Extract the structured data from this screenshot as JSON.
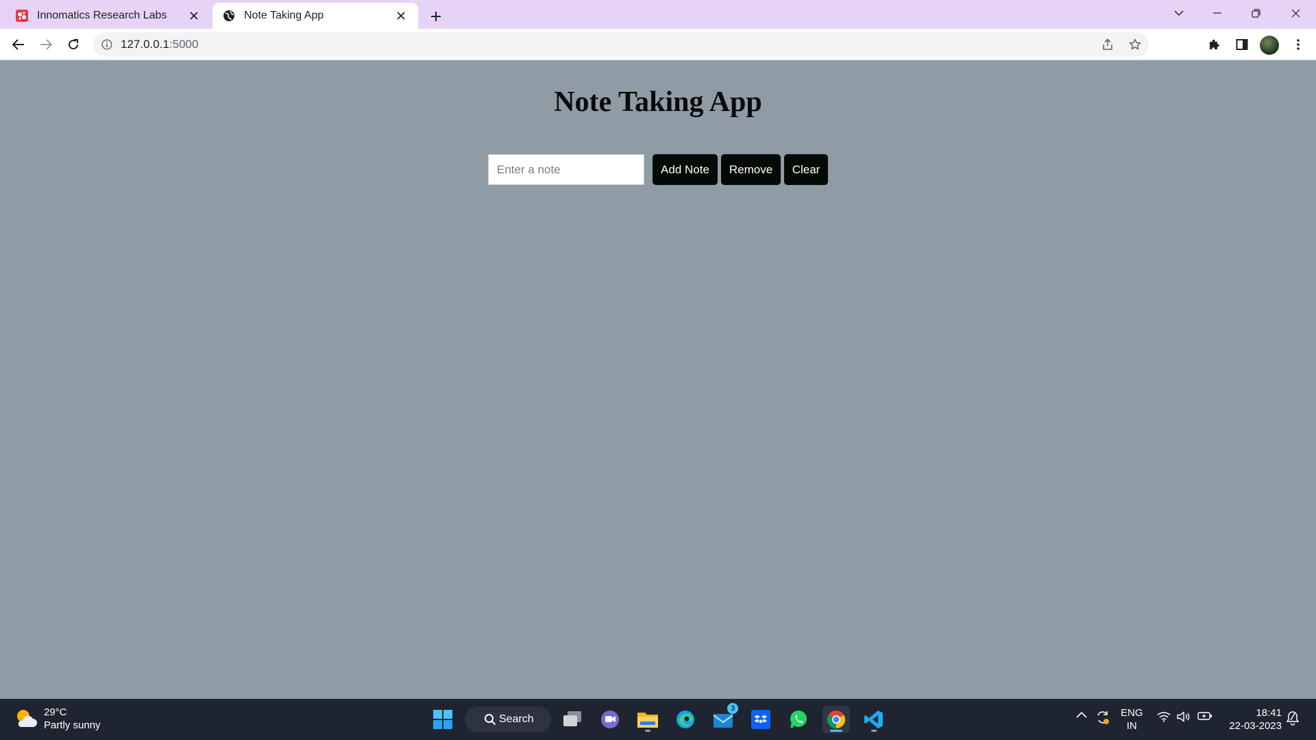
{
  "browser": {
    "tabs": [
      {
        "title": "Innomatics Research Labs",
        "active": false
      },
      {
        "title": "Note Taking App",
        "active": true
      }
    ],
    "url": {
      "host": "127.0.0.1",
      "port": ":5000"
    },
    "icons": {
      "new_tab": "plus-icon",
      "back": "arrow-left-icon",
      "forward": "arrow-right-icon",
      "reload": "reload-icon",
      "info": "info-icon",
      "share": "share-icon",
      "bookmark": "star-icon",
      "extensions": "puzzle-icon",
      "side_panel": "side-panel-icon",
      "menu": "kebab-menu-icon"
    },
    "tab_strip_color": "#e7d3f6"
  },
  "page": {
    "title": "Note Taking App",
    "note_input": {
      "placeholder": "Enter a note",
      "value": ""
    },
    "buttons": {
      "add": "Add Note",
      "remove": "Remove",
      "clear": "Clear"
    },
    "background_color": "#8f9ca6",
    "button_color": "#040a04"
  },
  "taskbar": {
    "weather": {
      "temp": "29°C",
      "condition": "Partly sunny"
    },
    "search_label": "Search",
    "mail_badge": "3",
    "apps": [
      "start",
      "search",
      "task-view",
      "teams-chat",
      "file-explorer",
      "edge",
      "mail",
      "dropbox",
      "whatsapp",
      "chrome",
      "vscode"
    ],
    "language": {
      "line1": "ENG",
      "line2": "IN"
    },
    "time": "18:41",
    "date": "22-03-2023"
  }
}
